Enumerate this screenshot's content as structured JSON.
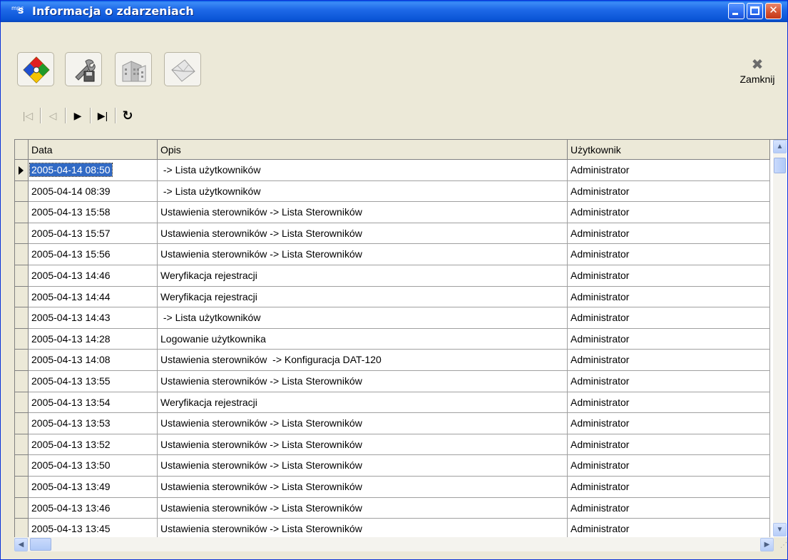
{
  "window": {
    "title": "Informacja o zdarzeniach",
    "icon_text_small": "mpc",
    "icon_text_large": "s"
  },
  "toolbar": {
    "close_label": "Zamknij",
    "buttons": [
      "puzzle-icon",
      "tools-save-icon",
      "buildings-icon",
      "envelope-icon"
    ]
  },
  "navigator": {
    "buttons": [
      "first-record",
      "prior-record",
      "next-record",
      "last-record",
      "refresh"
    ]
  },
  "grid": {
    "columns": [
      "Data",
      "Opis",
      "Użytkownik"
    ],
    "selected_row": 0,
    "rows": [
      {
        "data": "2005-04-14 08:50",
        "opis": " -> Lista użytkowników",
        "user": "Administrator"
      },
      {
        "data": "2005-04-14 08:39",
        "opis": " -> Lista użytkowników",
        "user": "Administrator"
      },
      {
        "data": "2005-04-13 15:58",
        "opis": "Ustawienia sterowników -> Lista Sterowników",
        "user": "Administrator"
      },
      {
        "data": "2005-04-13 15:57",
        "opis": "Ustawienia sterowników -> Lista Sterowników",
        "user": "Administrator"
      },
      {
        "data": "2005-04-13 15:56",
        "opis": "Ustawienia sterowników -> Lista Sterowników",
        "user": "Administrator"
      },
      {
        "data": "2005-04-13 14:46",
        "opis": "Weryfikacja rejestracji",
        "user": "Administrator"
      },
      {
        "data": "2005-04-13 14:44",
        "opis": "Weryfikacja rejestracji",
        "user": "Administrator"
      },
      {
        "data": "2005-04-13 14:43",
        "opis": " -> Lista użytkowników",
        "user": "Administrator"
      },
      {
        "data": "2005-04-13 14:28",
        "opis": "Logowanie użytkownika",
        "user": "Administrator"
      },
      {
        "data": "2005-04-13 14:08",
        "opis": "Ustawienia sterowników  -> Konfiguracja DAT-120",
        "user": "Administrator"
      },
      {
        "data": "2005-04-13 13:55",
        "opis": "Ustawienia sterowników -> Lista Sterowników",
        "user": "Administrator"
      },
      {
        "data": "2005-04-13 13:54",
        "opis": "Weryfikacja rejestracji",
        "user": "Administrator"
      },
      {
        "data": "2005-04-13 13:53",
        "opis": "Ustawienia sterowników -> Lista Sterowników",
        "user": "Administrator"
      },
      {
        "data": "2005-04-13 13:52",
        "opis": "Ustawienia sterowników -> Lista Sterowników",
        "user": "Administrator"
      },
      {
        "data": "2005-04-13 13:50",
        "opis": "Ustawienia sterowników -> Lista Sterowników",
        "user": "Administrator"
      },
      {
        "data": "2005-04-13 13:49",
        "opis": "Ustawienia sterowników -> Lista Sterowników",
        "user": "Administrator"
      },
      {
        "data": "2005-04-13 13:46",
        "opis": "Ustawienia sterowników -> Lista Sterowników",
        "user": "Administrator"
      },
      {
        "data": "2005-04-13 13:45",
        "opis": "Ustawienia sterowników -> Lista Sterowników",
        "user": "Administrator"
      }
    ]
  }
}
